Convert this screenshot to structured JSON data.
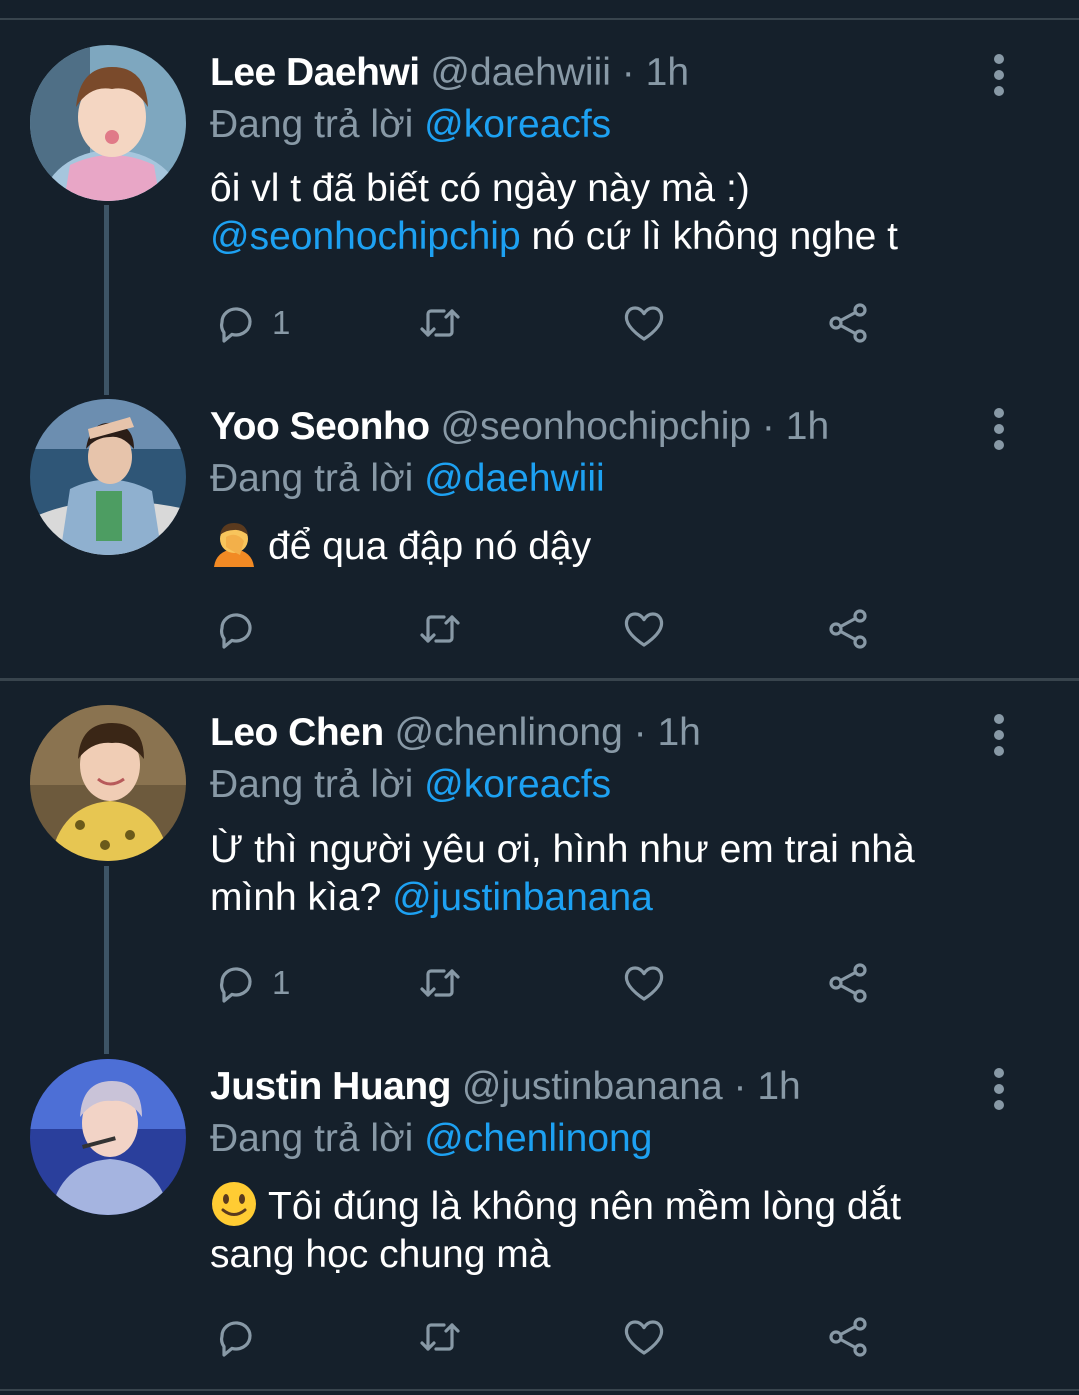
{
  "replying_prefix": "Đang trả lời",
  "tweets": [
    {
      "name": "Lee Daehwi",
      "handle": "@daehwiii",
      "separator": "·",
      "time": "1h",
      "replying_to": "@koreacfs",
      "line1": "ôi vl t đã biết có ngày này mà :)",
      "mention_in_text": "@seonhochipchip",
      "line2_rest": " nó cứ lì không nghe t",
      "reply_count": "1"
    },
    {
      "name": "Yoo Seonho",
      "handle": "@seonhochipchip",
      "separator": "·",
      "time": "1h",
      "replying_to": "@daehwiii",
      "emoji_icon": "facepalm-emoji",
      "text": "để qua đập nó dậy",
      "reply_count": ""
    },
    {
      "name": "Leo Chen",
      "handle": "@chenlinong",
      "separator": "·",
      "time": "1h",
      "replying_to": "@koreacfs",
      "line1": "Ừ thì người yêu ơi, hình như em trai nhà",
      "line2_start": "mình kìa? ",
      "mention_in_text": "@justinbanana",
      "reply_count": "1"
    },
    {
      "name": "Justin Huang",
      "handle": "@justinbanana",
      "separator": "·",
      "time": "1h",
      "replying_to": "@chenlinong",
      "emoji_icon": "slightly-smiling-emoji",
      "line1": "Tôi đúng là không nên mềm lòng dắt",
      "line2": "sang học chung mà",
      "reply_count": ""
    }
  ],
  "colors": {
    "background": "#15202b",
    "secondary_text": "#8899a6",
    "mention": "#1da1f2",
    "divider": "#38444d"
  },
  "icons": [
    "reply-icon",
    "retweet-icon",
    "like-icon",
    "share-icon",
    "more-options-icon"
  ]
}
